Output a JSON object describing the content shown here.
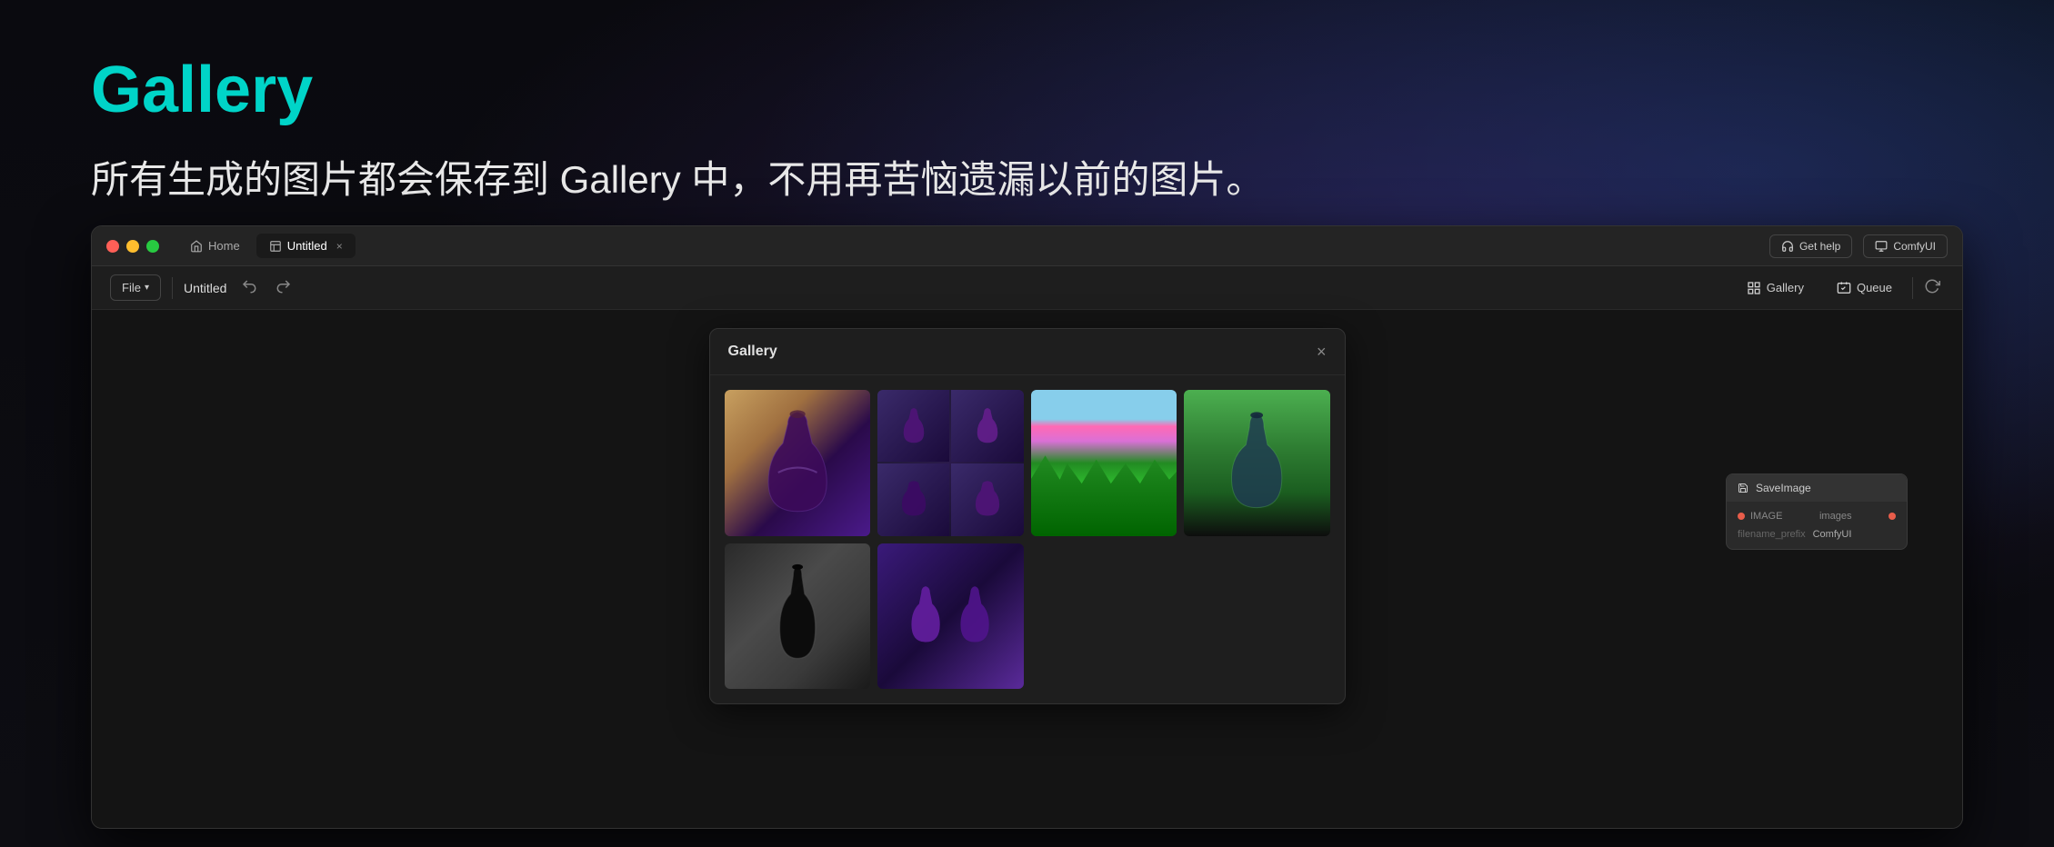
{
  "hero": {
    "title": "Gallery",
    "subtitle": "所有生成的图片都会保存到 Gallery 中，不用再苦恼遗漏以前的图片。"
  },
  "titleBar": {
    "homeTab": "Home",
    "activeTab": "Untitled",
    "closeBtn": "×",
    "getHelp": "Get help",
    "comfyUI": "ComfyUI"
  },
  "toolbar": {
    "fileBtn": "File",
    "chevron": "∨",
    "workflowName": "Untitled",
    "undoIcon": "↺",
    "redoIcon": "↻",
    "galleryBtn": "Gallery",
    "queueBtn": "Queue",
    "refreshIcon": "↺"
  },
  "galleryModal": {
    "title": "Gallery",
    "closeBtn": "×",
    "images": [
      {
        "id": 1,
        "type": "bottle-purple",
        "alt": "Purple bottle on warm background"
      },
      {
        "id": 2,
        "type": "bottles-grid",
        "alt": "Grid of purple bottles"
      },
      {
        "id": 3,
        "type": "forest-pink",
        "alt": "Pink forest landscape"
      },
      {
        "id": 4,
        "type": "bottle-forest",
        "alt": "Bottle in forest"
      },
      {
        "id": 5,
        "type": "bottle-black",
        "alt": "Black bottle"
      },
      {
        "id": 6,
        "type": "purple-mini",
        "alt": "Small purple bottles"
      }
    ]
  },
  "node": {
    "title": "SaveImage",
    "imageLabel": "IMAGE",
    "outputLabel": "images",
    "fieldLabel": "filename_prefix",
    "fieldValue": "ComfyUI"
  },
  "colors": {
    "accent": "#00d4c8",
    "background": "#0d0d0d",
    "windowBg": "#1a1a1a",
    "toolbarBg": "#1e1e1e"
  }
}
